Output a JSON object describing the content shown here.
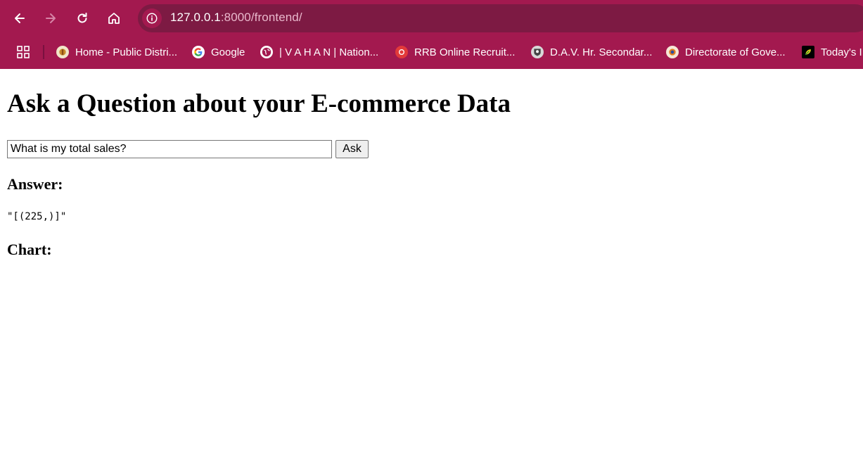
{
  "browser": {
    "url_host": "127.0.0.1",
    "url_path": ":8000/frontend/",
    "colors": {
      "toolbar": "#a3194f",
      "omnibox": "#7d1a43"
    },
    "nav_icons": [
      "back-arrow-icon",
      "forward-arrow-icon",
      "reload-icon",
      "home-icon"
    ],
    "bookmarks": [
      {
        "label": "Home - Public Distri...",
        "icon": "tn-emblem-icon"
      },
      {
        "label": "Google",
        "icon": "google-icon"
      },
      {
        "label": "| V A H A N | Nation...",
        "icon": "globe-icon"
      },
      {
        "label": "RRB Online Recruit...",
        "icon": "rrb-icon"
      },
      {
        "label": "D.A.V. Hr. Secondar...",
        "icon": "dav-icon"
      },
      {
        "label": "Directorate of Gove...",
        "icon": "emblem-icon"
      },
      {
        "label": "Today's IF",
        "icon": "leaf-icon"
      }
    ]
  },
  "page": {
    "title": "Ask a Question about your E-commerce Data",
    "question_value": "What is my total sales?",
    "ask_label": "Ask",
    "answer_heading": "Answer:",
    "answer_value": "\"[(225,)]\"",
    "chart_heading": "Chart:"
  }
}
